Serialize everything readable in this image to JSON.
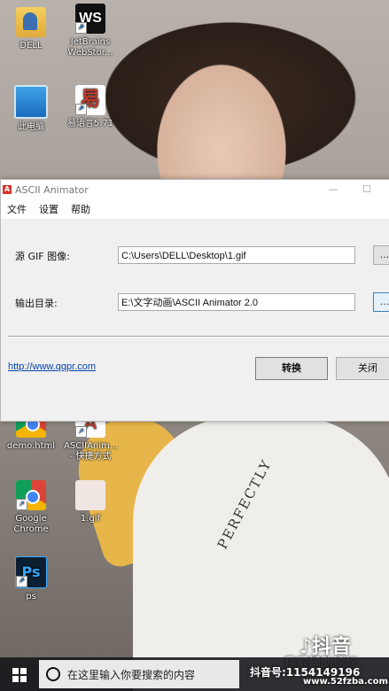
{
  "desktop": {
    "icons": [
      {
        "label": "DELL"
      },
      {
        "label": "JetBrains WebStor...",
        "glyph": "WS"
      },
      {
        "label": "此电脑"
      },
      {
        "label": "易语言5.71",
        "glyph": "易"
      },
      {
        "label": "demo.html"
      },
      {
        "label": "ASCIIAnim... - 快捷方式",
        "glyph": "A"
      },
      {
        "label": "Google Chrome"
      },
      {
        "label": "1.gif"
      },
      {
        "label": "ps",
        "glyph": "Ps"
      }
    ]
  },
  "shirt_text": "PERFECTLY",
  "window": {
    "title": "ASCII Animator",
    "app_icon": "A",
    "controls": {
      "minimize": "—",
      "maximize": "☐"
    },
    "menu": [
      "文件",
      "设置",
      "帮助"
    ],
    "source_label": "源 GIF 图像:",
    "source_value": "C:\\Users\\DELL\\Desktop\\1.gif",
    "output_label": "输出目录:",
    "output_value": "E:\\文字动画\\ASCII Animator 2.0",
    "browse_label": "...",
    "link": "http://www.qqpr.com",
    "convert_button": "转换",
    "close_button": "关闭"
  },
  "taskbar": {
    "search_placeholder": "在这里输入你要搜索的内容"
  },
  "watermarks": {
    "tiktok_logo": "♪抖音",
    "account": "抖音号:1154149196",
    "forum": "我爱辅助论坛",
    "site": "www.52fzba.com"
  }
}
